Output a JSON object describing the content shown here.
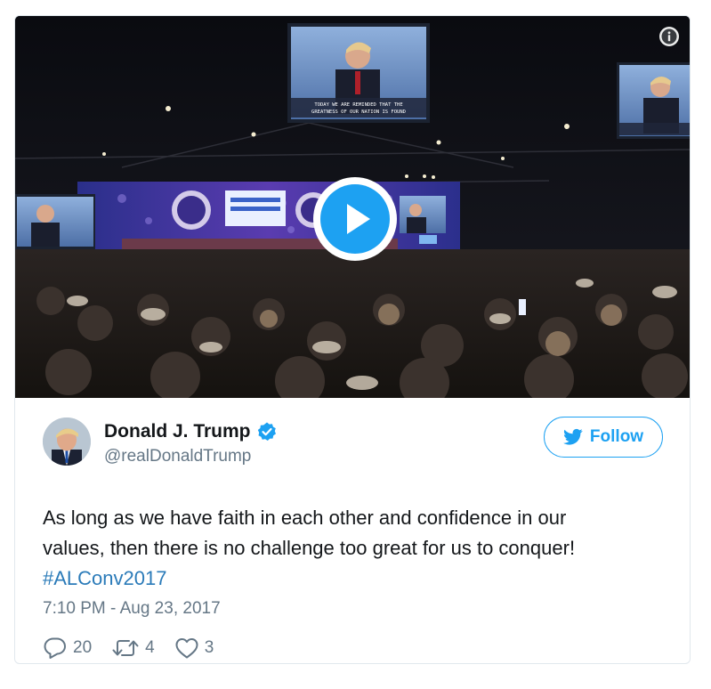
{
  "media": {
    "info_icon": "info-icon",
    "play_icon": "play-icon",
    "screen_caption": "TODAY WE ARE REMINDED THAT THE GREATNESS OF OUR NATION IS FOUND"
  },
  "author": {
    "display_name": "Donald J. Trump",
    "screen_name": "@realDonaldTrump",
    "verified_icon": "verified-badge-icon"
  },
  "follow": {
    "label": "Follow",
    "icon": "twitter-bird-icon"
  },
  "tweet": {
    "text_line1": "As long as we have faith in each other and confidence in our",
    "text_line2": "values, then there is no challenge too great for us to conquer!",
    "hashtag": "#ALConv2017",
    "timestamp": "7:10 PM - Aug 23, 2017"
  },
  "actions": {
    "replies": "20",
    "retweets": "4",
    "likes": "3"
  },
  "colors": {
    "accent": "#1da1f2",
    "hashtag": "#2b7bb9",
    "muted": "#657786",
    "text": "#14171a",
    "border": "#e1e8ed"
  }
}
